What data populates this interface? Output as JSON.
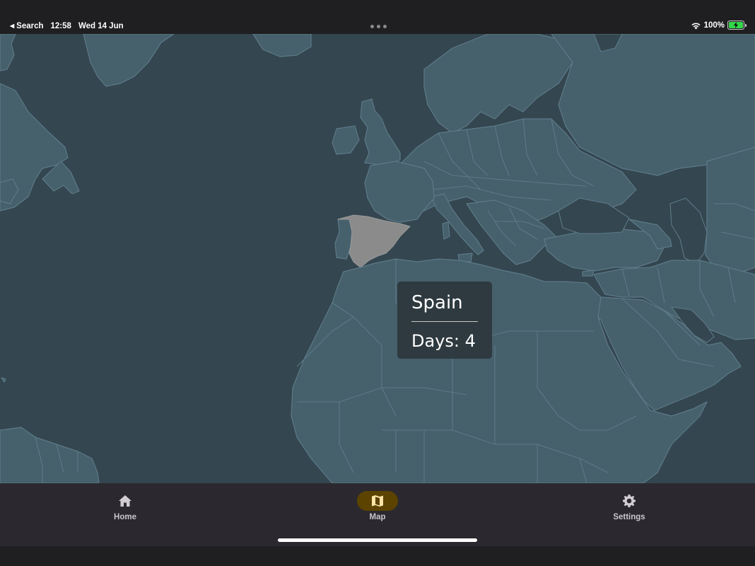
{
  "status_bar": {
    "back_label": "Search",
    "time": "12:58",
    "date": "Wed 14 Jun",
    "battery": "100%",
    "icons": [
      "back-arrow-icon",
      "more-dots-icon",
      "wifi-icon",
      "battery-charging-icon"
    ]
  },
  "map": {
    "highlighted_country": "Spain",
    "tooltip": {
      "title": "Spain",
      "days_label": "Days: 4"
    },
    "colors": {
      "ocean": "#34464f",
      "land": "#46606c",
      "border": "#5d7a88",
      "highlight": "#8b8b8b"
    }
  },
  "tab_bar": {
    "items": [
      {
        "label": "Home",
        "icon": "home-icon",
        "active": false
      },
      {
        "label": "Map",
        "icon": "map-icon",
        "active": true
      },
      {
        "label": "Settings",
        "icon": "gear-icon",
        "active": false
      }
    ],
    "active_color": "#5c4300"
  }
}
